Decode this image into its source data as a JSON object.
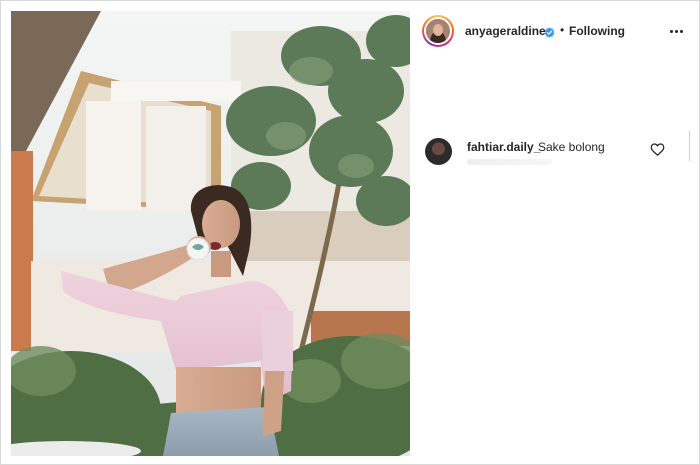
{
  "post": {
    "photo_alt": "",
    "author": {
      "username": "anyageraldine",
      "verified": true,
      "separator": "•",
      "follow_status": "Following"
    },
    "comments": [
      {
        "username": "fahtiar.daily_",
        "text": "Sake bolong"
      }
    ]
  },
  "icons": {
    "verified": "verified-badge-icon",
    "more": "more-options-icon",
    "like": "heart-icon"
  },
  "colors": {
    "verified_blue": "#3897f0",
    "text": "#262626",
    "border": "#d8d8d8"
  }
}
